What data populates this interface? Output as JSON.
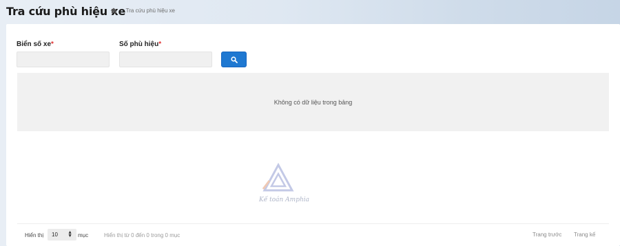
{
  "header": {
    "title": "Tra cứu phù hiệu xe",
    "breadcrumb": {
      "current": "Tra cứu phù hiệu xe"
    }
  },
  "form": {
    "plate_label": "Biển số xe",
    "badge_label": "Số phù hiệu",
    "required_mark": "*",
    "plate_value": "",
    "badge_value": ""
  },
  "table": {
    "empty_message": "Không có dữ liệu trong bảng"
  },
  "footer": {
    "show_label": "Hiển thị",
    "page_size": "10",
    "entries_label": "mục",
    "info": "Hiển thị từ 0 đến 0 trong 0 mục",
    "prev": "Trang trước",
    "next": "Trang kế"
  },
  "watermark": {
    "text": "Kế toán Amphia"
  },
  "colors": {
    "primary": "#1f78d1",
    "required": "#e03131"
  }
}
